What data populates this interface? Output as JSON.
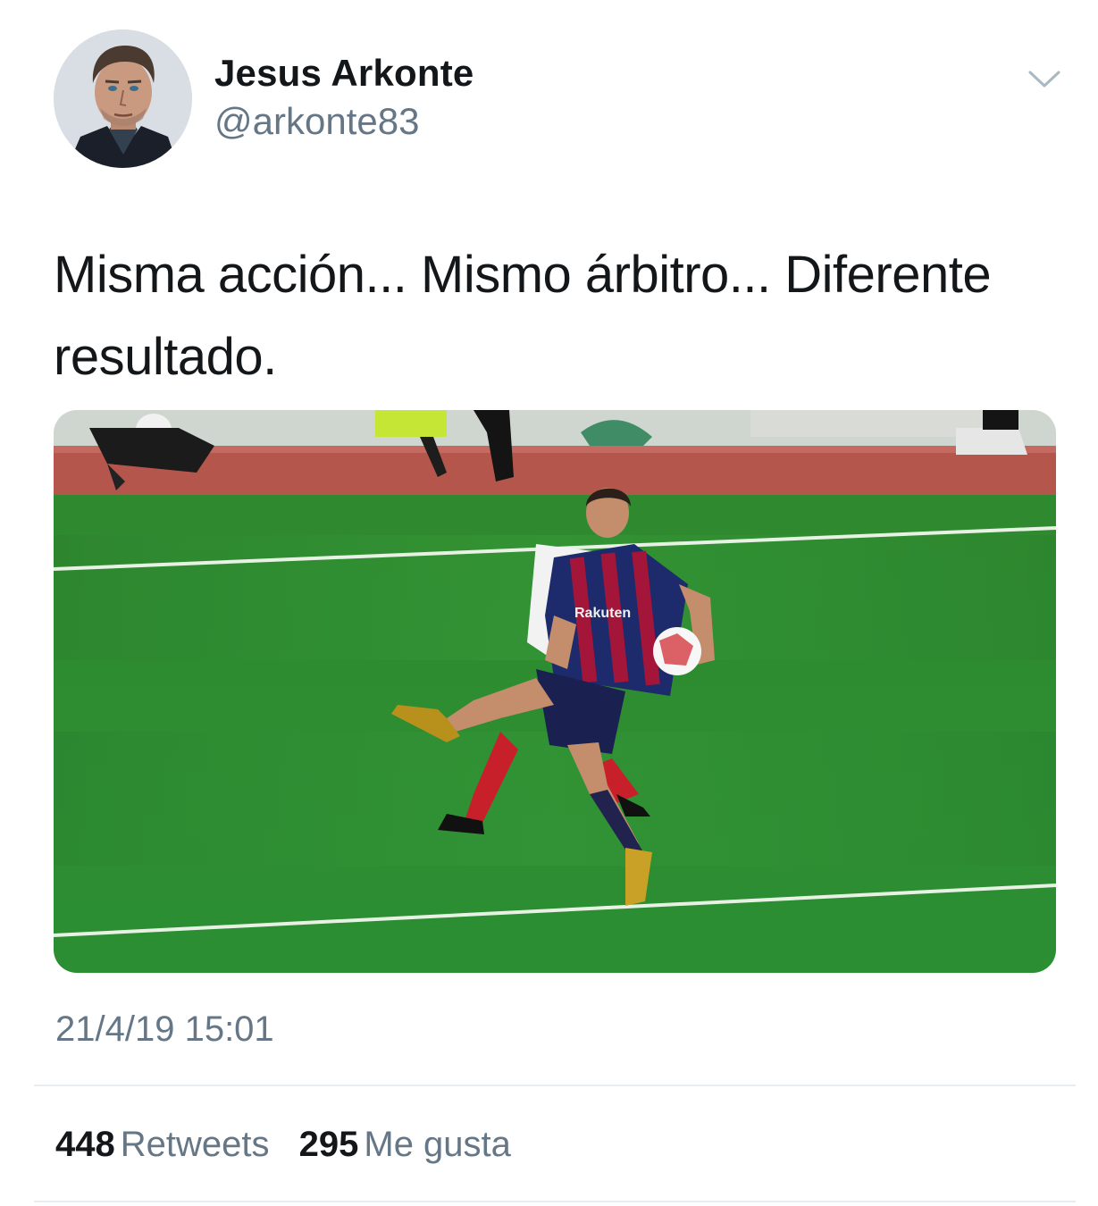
{
  "tweet": {
    "author": {
      "display_name": "Jesus Arkonte",
      "handle": "@arkonte83",
      "avatar_icon": "profile-avatar"
    },
    "menu_icon": "chevron-down-icon",
    "text": "Misma acción... Mismo árbitro... Diferente resultado.",
    "media": {
      "kind": "photo",
      "shirt_sponsor_text": "Rakuten"
    },
    "timestamp": "21/4/19 15:01",
    "stats": {
      "retweets_count": "448",
      "retweets_label": "Retweets",
      "likes_count": "295",
      "likes_label": "Me gusta"
    }
  },
  "colors": {
    "text_primary": "#14171a",
    "text_secondary": "#657786",
    "divider": "#e6ecf0",
    "pitch_green": "#2e8f33",
    "barca_blue": "#1d2a6b",
    "barca_red": "#a3163a"
  }
}
